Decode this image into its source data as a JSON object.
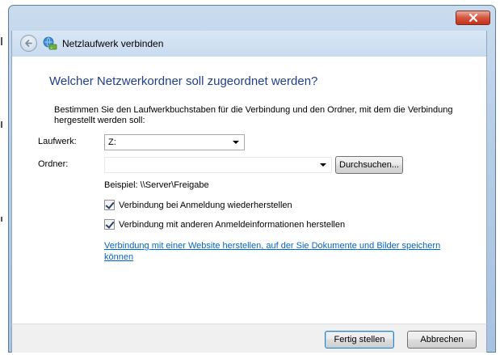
{
  "window": {
    "title": "Netzlaufwerk verbinden"
  },
  "heading": "Welcher Netzwerkordner soll zugeordnet werden?",
  "description": "Bestimmen Sie den Laufwerkbuchstaben für die Verbindung und den Ordner, mit dem die Verbindung hergestellt werden soll:",
  "drive": {
    "label": "Laufwerk:",
    "value": "Z:"
  },
  "folder": {
    "label": "Ordner:",
    "value": "",
    "browse_label": "Durchsuchen...",
    "example": "Beispiel: \\\\Server\\Freigabe"
  },
  "options": {
    "reconnect_label": "Verbindung bei Anmeldung wiederherstellen",
    "reconnect_checked": true,
    "other_credentials_label": "Verbindung mit anderen Anmeldeinformationen herstellen",
    "other_credentials_checked": true
  },
  "link": "Verbindung mit einer Website herstellen, auf der Sie Dokumente und Bilder speichern können",
  "footer": {
    "finish_label": "Fertig stellen",
    "cancel_label": "Abbrechen"
  },
  "colors": {
    "heading": "#1e3f8a",
    "link": "#0066cc",
    "close_button": "#c4321a"
  },
  "icons": [
    "close-icon",
    "back-arrow-icon",
    "network-drive-icon",
    "chevron-down-icon",
    "checkmark-icon"
  ]
}
